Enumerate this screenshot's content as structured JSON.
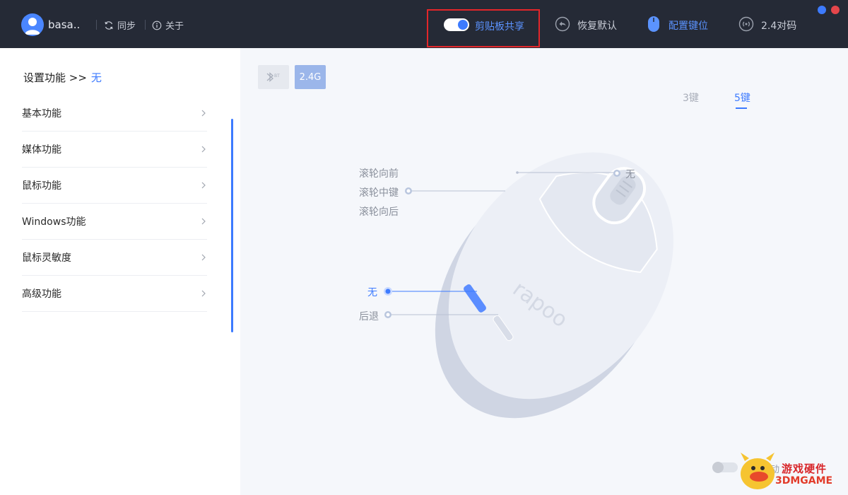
{
  "header": {
    "username": "basa..",
    "sync_label": "同步",
    "about_label": "关于",
    "clipboard_label": "剪贴板共享",
    "clipboard_enabled": true,
    "restore_label": "恢复默认",
    "config_keys_label": "配置键位",
    "pair_label": "2.4对码",
    "window_dots": [
      "#3d7bff",
      "#e5464b"
    ]
  },
  "sidebar": {
    "title": "设置功能 >>",
    "title_value": "无",
    "items": [
      {
        "label": "基本功能"
      },
      {
        "label": "媒体功能"
      },
      {
        "label": "鼠标功能"
      },
      {
        "label": "Windows功能"
      },
      {
        "label": "鼠标灵敏度"
      },
      {
        "label": "高级功能"
      }
    ]
  },
  "main": {
    "mode_bt_label": "BT",
    "mode_24_label": "2.4G",
    "key_tabs": [
      {
        "label": "3键",
        "active": false
      },
      {
        "label": "5键",
        "active": true
      }
    ],
    "mouse_labels": {
      "wheel_up": "滚轮向前",
      "wheel_up_value": "无",
      "wheel_middle": "滚轮中键",
      "wheel_down": "滚轮向后",
      "forward": "无",
      "back": "后退"
    },
    "brand_text": "rapoo",
    "bottom_toggle_text": "动",
    "bottom_toggle_enabled": false
  },
  "watermark": {
    "line1": "游戏硬件",
    "line2": "3DMGAME"
  },
  "colors": {
    "accent": "#3d7bff",
    "topbar_bg": "#252a36",
    "highlight_box": "#e3262a"
  }
}
